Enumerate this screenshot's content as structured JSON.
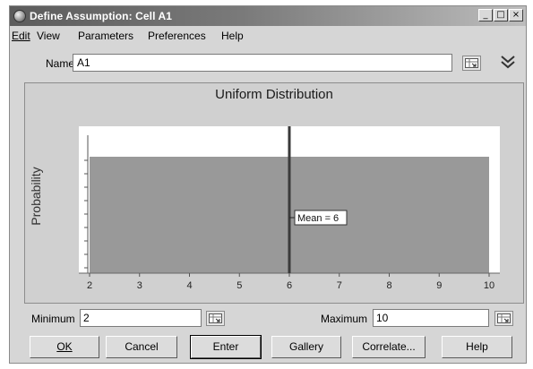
{
  "window": {
    "title": "Define Assumption: Cell A1"
  },
  "menu": [
    {
      "label": "Edit"
    },
    {
      "label": "View"
    },
    {
      "label": "Parameters"
    },
    {
      "label": "Preferences"
    },
    {
      "label": "Help"
    }
  ],
  "name_field": {
    "label": "Name:",
    "value": "A1"
  },
  "chart_data": {
    "type": "bar",
    "title": "Uniform Distribution",
    "xlabel": "",
    "ylabel": "Probability",
    "x_ticks": [
      2,
      3,
      4,
      5,
      6,
      7,
      8,
      9,
      10
    ],
    "xlim": [
      2,
      10
    ],
    "distribution": {
      "name": "uniform",
      "min": 2,
      "max": 10
    },
    "mean_marker": {
      "x": 6,
      "label": "Mean = 6"
    },
    "colors": {
      "fill": "#999999",
      "mean_line": "#3a3a3a",
      "plot_bg": "#ffffff"
    }
  },
  "parameters": {
    "minimum_label": "Minimum",
    "minimum_value": "2",
    "maximum_label": "Maximum",
    "maximum_value": "10"
  },
  "buttons": [
    {
      "label": "OK"
    },
    {
      "label": "Cancel"
    },
    {
      "label": "Enter"
    },
    {
      "label": "Gallery"
    },
    {
      "label": "Correlate..."
    },
    {
      "label": "Help"
    }
  ]
}
